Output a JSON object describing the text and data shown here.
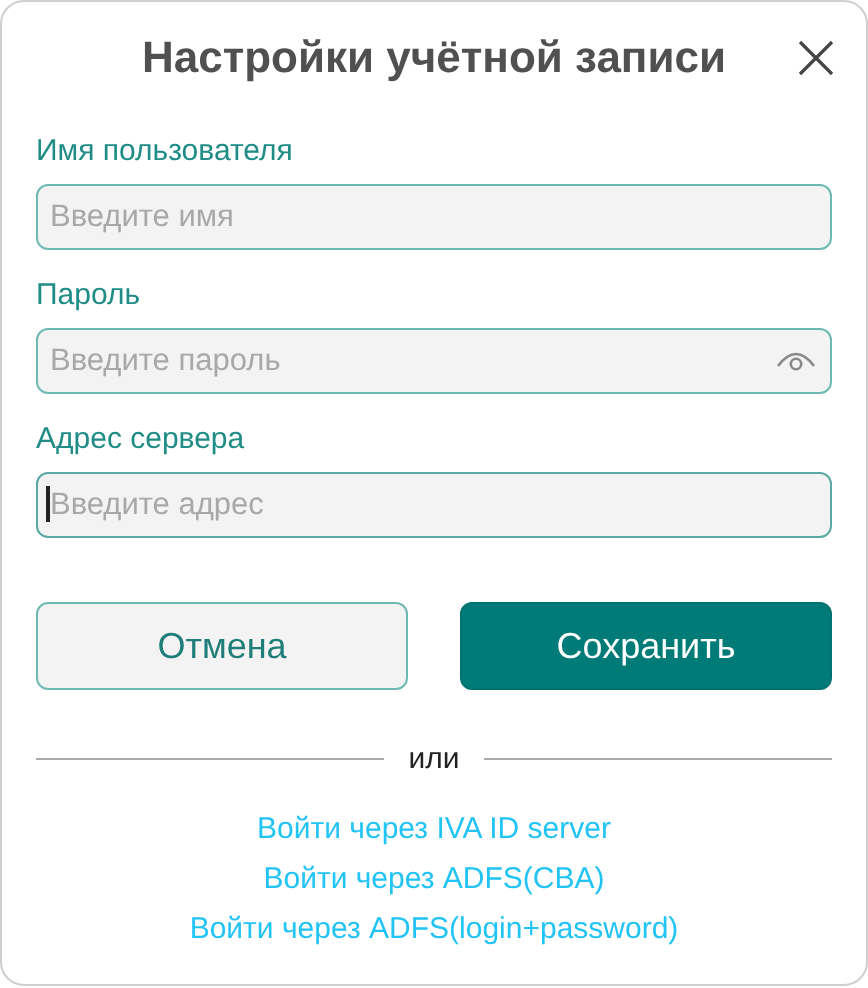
{
  "dialog": {
    "title": "Настройки учётной записи"
  },
  "fields": [
    {
      "kind": "text",
      "label": "Имя пользователя",
      "placeholder": "Введите имя",
      "focused": false
    },
    {
      "kind": "password",
      "label": "Пароль",
      "placeholder": "Введите пароль",
      "focused": false
    },
    {
      "kind": "text",
      "label": "Адрес сервера",
      "placeholder": "Введите адрес",
      "focused": true
    }
  ],
  "buttons": [
    {
      "kind": "secondary",
      "label": "Отмена"
    },
    {
      "kind": "primary",
      "label": "Сохранить"
    }
  ],
  "separator": "или",
  "links": [
    "Войти через IVA ID server",
    "Войти через ADFS(CBA)",
    "Войти через ADFS(login+password)"
  ]
}
